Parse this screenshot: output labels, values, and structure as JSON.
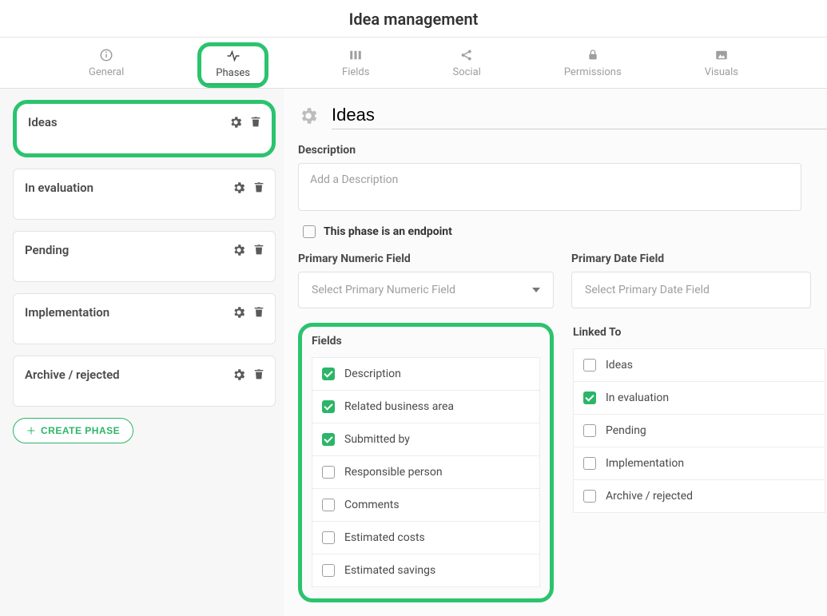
{
  "page_title": "Idea management",
  "tabs": {
    "general": "General",
    "phases": "Phases",
    "fields": "Fields",
    "social": "Social",
    "permissions": "Permissions",
    "visuals": "Visuals"
  },
  "sidebar": {
    "phases": [
      {
        "label": "Ideas"
      },
      {
        "label": "In evaluation"
      },
      {
        "label": "Pending"
      },
      {
        "label": "Implementation"
      },
      {
        "label": "Archive / rejected"
      }
    ],
    "create_label": "CREATE PHASE"
  },
  "main": {
    "title": "Ideas",
    "description_label": "Description",
    "description_placeholder": "Add a Description",
    "endpoint_label": "This phase is an endpoint",
    "primary_numeric_label": "Primary Numeric Field",
    "primary_numeric_placeholder": "Select Primary Numeric Field",
    "primary_date_label": "Primary Date Field",
    "primary_date_placeholder": "Select Primary Date Field",
    "fields_title": "Fields",
    "linked_title": "Linked To",
    "fields": [
      {
        "label": "Description",
        "checked": true
      },
      {
        "label": "Related business area",
        "checked": true
      },
      {
        "label": "Submitted by",
        "checked": true
      },
      {
        "label": "Responsible person",
        "checked": false
      },
      {
        "label": "Comments",
        "checked": false
      },
      {
        "label": "Estimated costs",
        "checked": false
      },
      {
        "label": "Estimated savings",
        "checked": false
      }
    ],
    "linked": [
      {
        "label": "Ideas",
        "checked": false
      },
      {
        "label": "In evaluation",
        "checked": true
      },
      {
        "label": "Pending",
        "checked": false
      },
      {
        "label": "Implementation",
        "checked": false
      },
      {
        "label": "Archive / rejected",
        "checked": false
      }
    ]
  }
}
